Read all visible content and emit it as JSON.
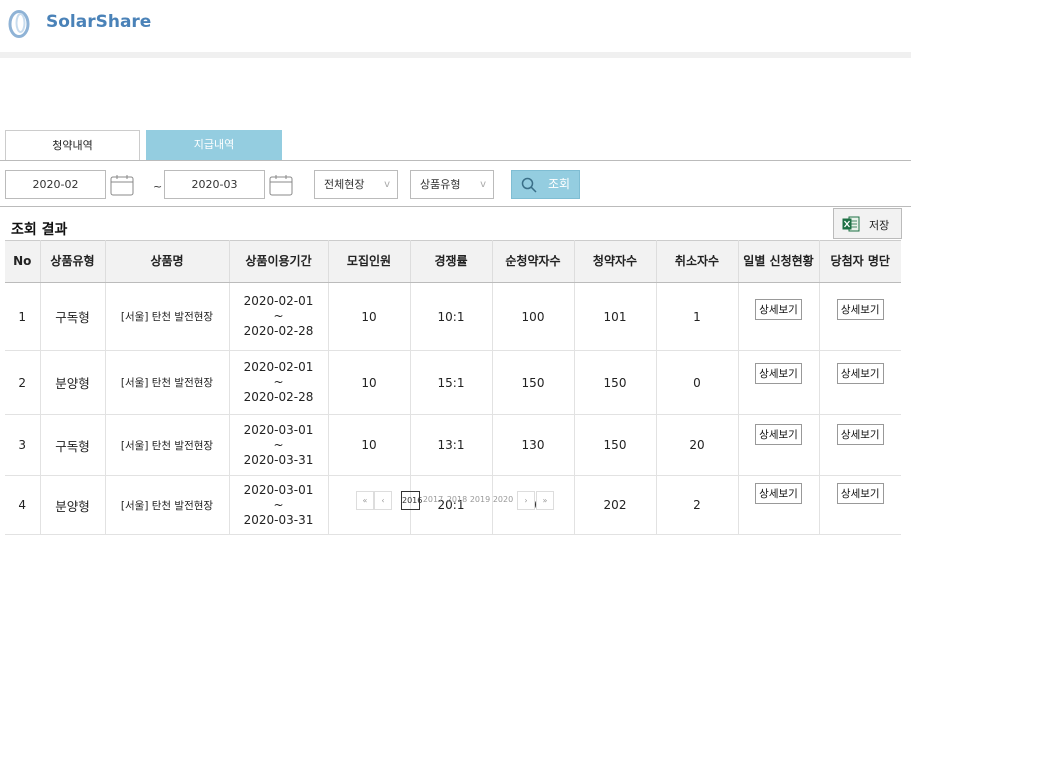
{
  "app": {
    "name": "SolarShare"
  },
  "tabs": [
    {
      "label": "청약내역",
      "active": true
    },
    {
      "label": "지급내역",
      "active": false
    }
  ],
  "filters": {
    "date_from": "2020-02",
    "date_to": "2020-03",
    "separator": "~",
    "site_select": "전체현장",
    "product_type_select": "상품유형",
    "chevron": "v",
    "search_label": "조회"
  },
  "results": {
    "title": "조회 결과",
    "save_label": "저장",
    "columns": [
      "No",
      "상품유형",
      "상품명",
      "상품이용기간",
      "모집인원",
      "경쟁률",
      "순청약자수",
      "청약자수",
      "취소자수",
      "일별 신청현황",
      "당첨자 명단"
    ],
    "rows": [
      {
        "no": "1",
        "type": "구독형",
        "name": "[서울] 탄천 발전현장",
        "period_start": "2020-02-01",
        "period_sep": "~",
        "period_end": "2020-02-28",
        "recruit": "10",
        "ratio": "10:1",
        "net_applicants": "100",
        "applicants": "101",
        "cancels": "1",
        "daily_btn": "상세보기",
        "winners_btn": "상세보기"
      },
      {
        "no": "2",
        "type": "분양형",
        "name": "[서울] 탄천 발전현장",
        "period_start": "2020-02-01",
        "period_sep": "~",
        "period_end": "2020-02-28",
        "recruit": "10",
        "ratio": "15:1",
        "net_applicants": "150",
        "applicants": "150",
        "cancels": "0",
        "daily_btn": "상세보기",
        "winners_btn": "상세보기"
      },
      {
        "no": "3",
        "type": "구독형",
        "name": "[서울] 탄천 발전현장",
        "period_start": "2020-03-01",
        "period_sep": "~",
        "period_end": "2020-03-31",
        "recruit": "10",
        "ratio": "13:1",
        "net_applicants": "130",
        "applicants": "150",
        "cancels": "20",
        "daily_btn": "상세보기",
        "winners_btn": "상세보기"
      },
      {
        "no": "4",
        "type": "분양형",
        "name": "[서울] 탄천 발전현장",
        "period_start": "2020-03-01",
        "period_sep": "~",
        "period_end": "2020-03-31",
        "recruit": "10",
        "ratio": "20:1",
        "net_applicants": "200",
        "applicants": "202",
        "cancels": "2",
        "daily_btn": "상세보기",
        "winners_btn": "상세보기"
      }
    ]
  },
  "pagination": {
    "first": "«",
    "prev": "‹",
    "pages": [
      "2016",
      "2017",
      "2018",
      "2019",
      "2020"
    ],
    "current": "2016",
    "next": "›",
    "last": "»"
  },
  "colors": {
    "brand": "#4a82b8",
    "accent": "#94cde0"
  }
}
